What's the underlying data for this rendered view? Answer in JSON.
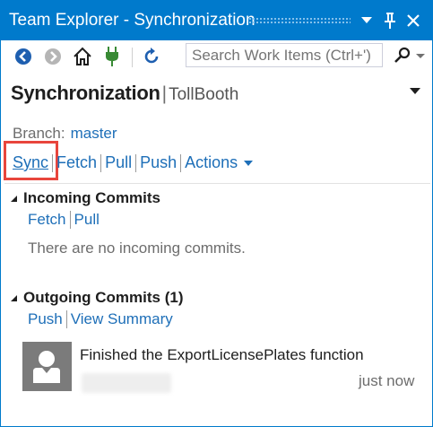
{
  "window": {
    "title": "Team Explorer - Synchronization",
    "accent": "#007acc",
    "title_buttons": [
      "dropdown-icon",
      "pin-icon",
      "close-icon"
    ]
  },
  "toolbar": {
    "icons": [
      "back-icon",
      "forward-icon",
      "home-icon",
      "connect-icon",
      "refresh-icon"
    ],
    "search_placeholder": "Search Work Items (Ctrl+')"
  },
  "header": {
    "title": "Synchronization",
    "separator": "|",
    "repo": "TollBooth"
  },
  "branch": {
    "label": "Branch:",
    "value": "master"
  },
  "actions": {
    "sync": "Sync",
    "fetch": "Fetch",
    "pull": "Pull",
    "push": "Push",
    "more": "Actions"
  },
  "incoming": {
    "title": "Incoming Commits",
    "fetch": "Fetch",
    "pull": "Pull",
    "empty_message": "There are no incoming commits."
  },
  "outgoing": {
    "title": "Outgoing Commits (1)",
    "push": "Push",
    "view_summary": "View Summary",
    "commits": [
      {
        "message": "Finished the ExportLicensePlates function",
        "time": "just now"
      }
    ]
  },
  "highlight_color": "#e8453c"
}
